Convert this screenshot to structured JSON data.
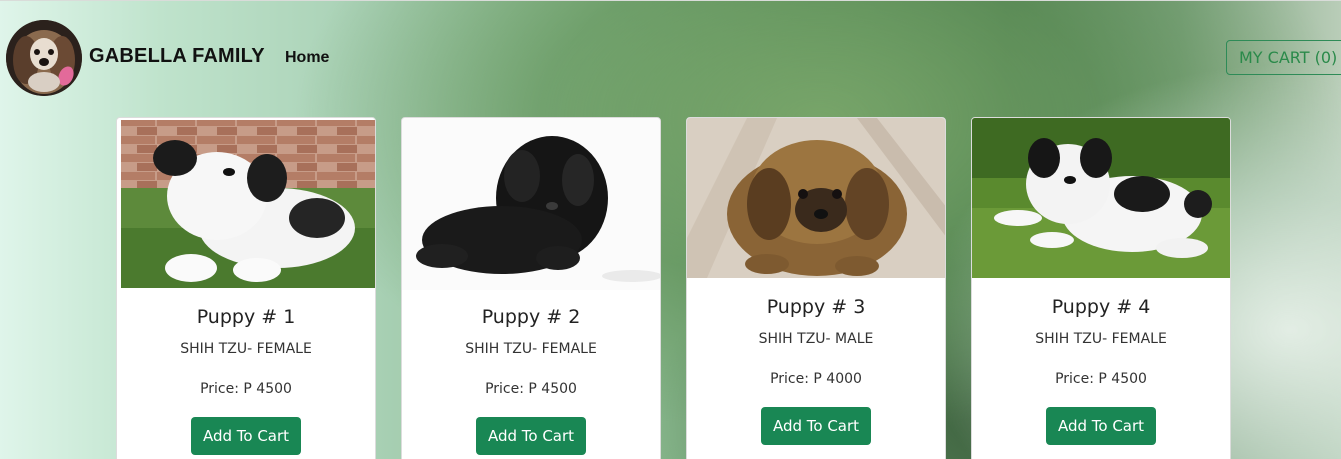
{
  "navbar": {
    "brand": "GABELLA FAMILY",
    "home_label": "Home",
    "cart_label": "MY CART (0)"
  },
  "colors": {
    "accent": "#198754",
    "cart_outline": "#2e8b57"
  },
  "products": [
    {
      "title": "Puppy # 1",
      "breed": "SHIH TZU- FEMALE",
      "price": "Price: P 4500",
      "button": "Add To Cart",
      "photo": "white-black-shih-tzu-puppy-on-grass"
    },
    {
      "title": "Puppy # 2",
      "breed": "SHIH TZU- FEMALE",
      "price": "Price: P 4500",
      "button": "Add To Cart",
      "photo": "black-shih-tzu-puppy-white-background"
    },
    {
      "title": "Puppy # 3",
      "breed": "SHIH TZU- MALE",
      "price": "Price: P 4000",
      "button": "Add To Cart",
      "photo": "brown-shih-tzu-puppy-on-tiles"
    },
    {
      "title": "Puppy # 4",
      "breed": "SHIH TZU- FEMALE",
      "price": "Price: P 4500",
      "button": "Add To Cart",
      "photo": "white-black-shih-tzu-puppy-lying-on-grass"
    }
  ]
}
